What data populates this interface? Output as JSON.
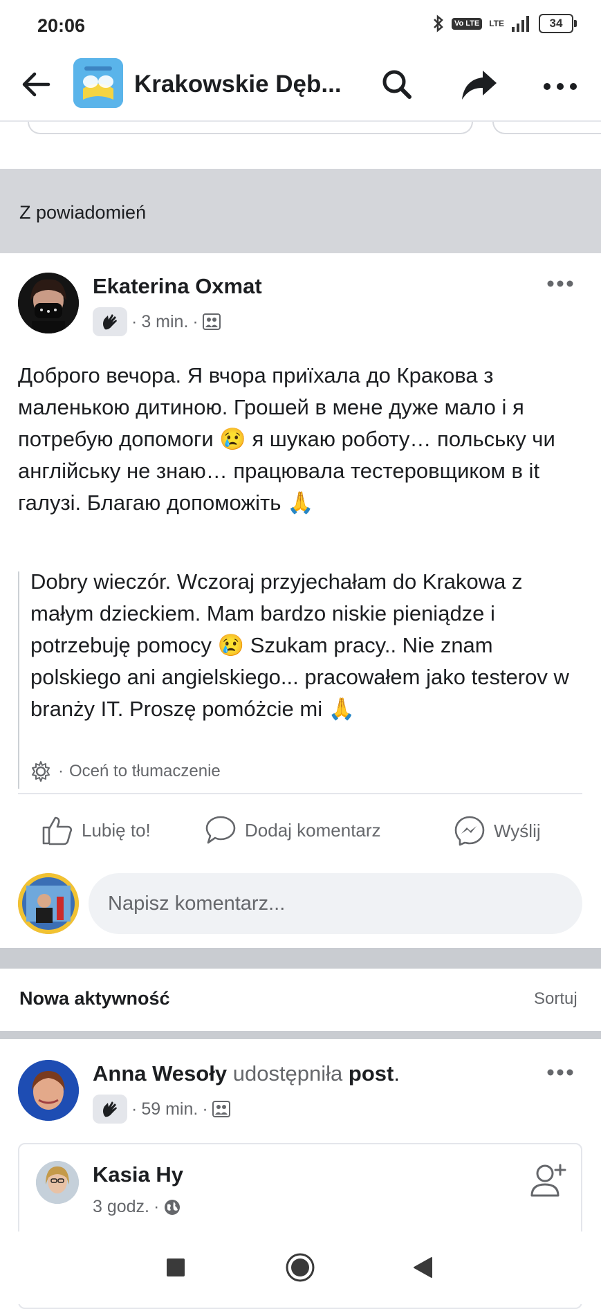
{
  "status": {
    "time": "20:06",
    "volte": "Vo LTE",
    "lte": "LTE",
    "battery": "34"
  },
  "header": {
    "group_name": "Krakowskie Dęb..."
  },
  "notification_section": {
    "label": "Z powiadomień"
  },
  "post": {
    "author": "Ekaterina Oxmat",
    "time": "3 min.",
    "text": "Доброго вечора. Я вчора приїхала до Кракова з маленькою дитиною. Грошей в мене дуже мало і я потребую допомоги 😢 я шукаю роботу… польську чи англійську не знаю… працювала тестеровщиком в it галузі. Благаю допоможіть 🙏",
    "translation": "Dobry wieczór. Wczoraj przyjechałam do Krakowa z małym dzieckiem. Mam bardzo niskie pieniądze i potrzebuję pomocy 😢 Szukam pracy.. Nie znam polskiego ani angielskiego... pracowałem jako testerov w branży IT. Proszę pomóżcie mi 🙏",
    "rate_translation": "Oceń to tłumaczenie"
  },
  "actions": {
    "like": "Lubię to!",
    "comment": "Dodaj komentarz",
    "send": "Wyślij"
  },
  "comment_input": {
    "placeholder": "Napisz komentarz..."
  },
  "activity": {
    "title": "Nowa aktywność",
    "sort": "Sortuj"
  },
  "shared_post": {
    "author": "Anna Wesoły",
    "verb": "udostępniła",
    "object": "post",
    "time": "59 min.",
    "original_author": "Kasia Hy",
    "original_time": "3 godz."
  },
  "colors": {
    "section_bg": "#d4d6da",
    "muted_text": "#65676b",
    "input_bg": "#f0f2f5",
    "group_avatar": "#4aa9e6"
  }
}
